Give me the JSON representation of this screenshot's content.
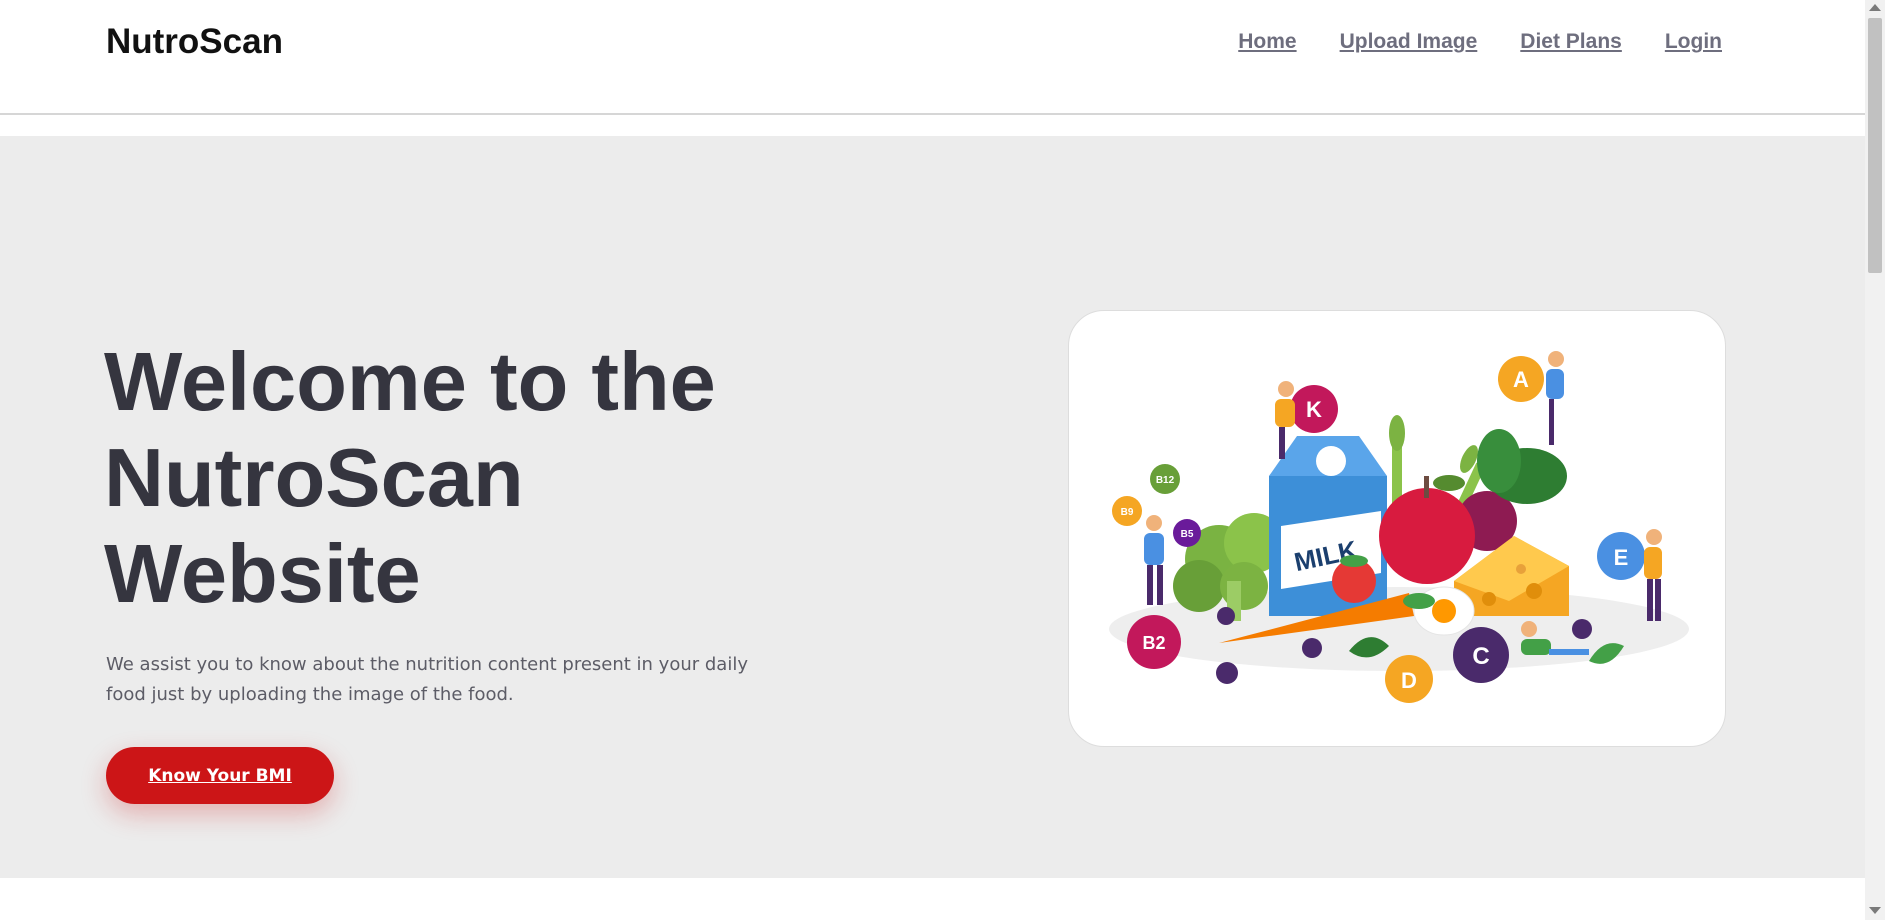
{
  "header": {
    "brand": "NutroScan",
    "nav": [
      {
        "label": "Home"
      },
      {
        "label": "Upload Image"
      },
      {
        "label": "Diet Plans"
      },
      {
        "label": "Login"
      }
    ]
  },
  "hero": {
    "title_lines": [
      "Welcome to the",
      "NutroScan",
      "Website"
    ],
    "description": "We assist you to know about the nutrition content present in your daily food just by uploading the image of the food.",
    "cta_label": "Know Your BMI",
    "illustration": {
      "milk_text": "MILK",
      "vitamins": [
        "K",
        "A",
        "B12",
        "B9",
        "B5",
        "E",
        "B2",
        "D",
        "C"
      ]
    }
  },
  "colors": {
    "accent": "#cc1517",
    "hero_bg": "#ececec",
    "title": "#35353f",
    "nav_link": "#6e6e7e"
  }
}
